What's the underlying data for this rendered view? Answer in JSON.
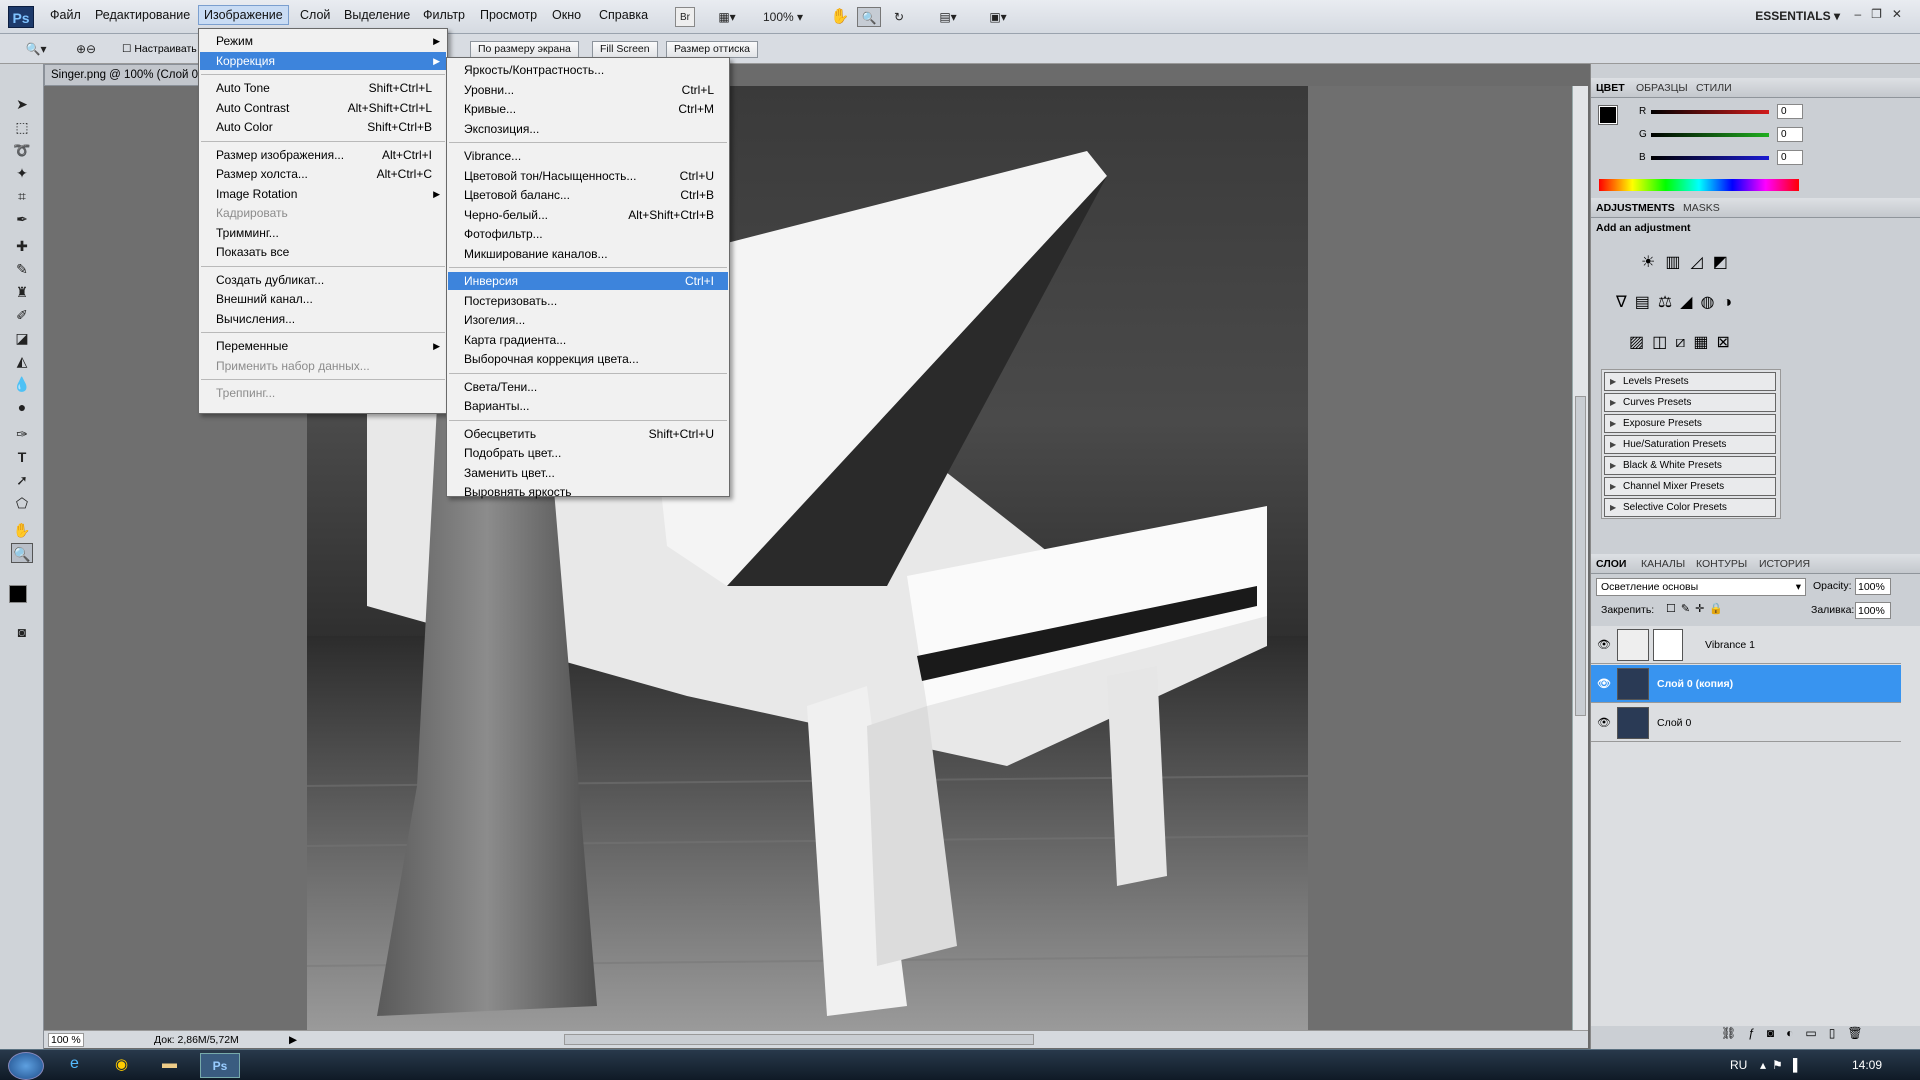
{
  "menubar": {
    "logo": "Ps",
    "items": [
      "Файл",
      "Редактирование",
      "Изображение",
      "Слой",
      "Выделение",
      "Фильтр",
      "Просмотр",
      "Окно",
      "Справка"
    ],
    "active_index": 2,
    "zoom": "100%",
    "workspace": "ESSENTIALS"
  },
  "options": {
    "resize_windows": "Настраивать",
    "buttons": [
      "По размеру экрана",
      "Fill Screen",
      "Размер оттиска"
    ]
  },
  "document": {
    "tab_title": "Singer.png @ 100% (Слой 0",
    "status_zoom": "100 %",
    "status_doc": "Док: 2,86M/5,72M"
  },
  "image_menu": {
    "items": [
      {
        "label": "Режим",
        "submenu": true
      },
      {
        "label": "Коррекция",
        "submenu": true,
        "highlight": true
      },
      {
        "label": "Auto Tone",
        "shortcut": "Shift+Ctrl+L"
      },
      {
        "label": "Auto Contrast",
        "shortcut": "Alt+Shift+Ctrl+L"
      },
      {
        "label": "Auto Color",
        "shortcut": "Shift+Ctrl+B"
      },
      {
        "label": "Размер изображения...",
        "shortcut": "Alt+Ctrl+I"
      },
      {
        "label": "Размер холста...",
        "shortcut": "Alt+Ctrl+C"
      },
      {
        "label": "Image Rotation",
        "submenu": true
      },
      {
        "label": "Кадрировать",
        "disabled": true
      },
      {
        "label": "Тримминг..."
      },
      {
        "label": "Показать все"
      },
      {
        "label": "Создать дубликат..."
      },
      {
        "label": "Внешний канал..."
      },
      {
        "label": "Вычисления..."
      },
      {
        "label": "Переменные",
        "submenu": true
      },
      {
        "label": "Применить набор данных...",
        "disabled": true
      },
      {
        "label": "Треппинг...",
        "disabled": true
      }
    ]
  },
  "correction_menu": {
    "items": [
      {
        "label": "Яркость/Контрастность..."
      },
      {
        "label": "Уровни...",
        "shortcut": "Ctrl+L"
      },
      {
        "label": "Кривые...",
        "shortcut": "Ctrl+M"
      },
      {
        "label": "Экспозиция..."
      },
      {
        "label": "Vibrance..."
      },
      {
        "label": "Цветовой тон/Насыщенность...",
        "shortcut": "Ctrl+U"
      },
      {
        "label": "Цветовой баланс...",
        "shortcut": "Ctrl+B"
      },
      {
        "label": "Черно-белый...",
        "shortcut": "Alt+Shift+Ctrl+B"
      },
      {
        "label": "Фотофильтр..."
      },
      {
        "label": "Микширование каналов..."
      },
      {
        "label": "Инверсия",
        "shortcut": "Ctrl+I",
        "highlight": true
      },
      {
        "label": "Постеризовать..."
      },
      {
        "label": "Изогелия..."
      },
      {
        "label": "Карта градиента..."
      },
      {
        "label": "Выборочная коррекция цвета..."
      },
      {
        "label": "Света/Тени..."
      },
      {
        "label": "Варианты..."
      },
      {
        "label": "Обесцветить",
        "shortcut": "Shift+Ctrl+U"
      },
      {
        "label": "Подобрать цвет..."
      },
      {
        "label": "Заменить цвет..."
      },
      {
        "label": "Выровнять яркость"
      }
    ]
  },
  "color_panel": {
    "tabs": [
      "ЦВЕТ",
      "ОБРАЗЦЫ",
      "СТИЛИ"
    ],
    "channels": [
      {
        "name": "R",
        "value": "0",
        "color": "#d21b1b"
      },
      {
        "name": "G",
        "value": "0",
        "color": "#1fae1f"
      },
      {
        "name": "B",
        "value": "0",
        "color": "#1b1bd2"
      }
    ]
  },
  "adjustments_panel": {
    "tabs": [
      "ADJUSTMENTS",
      "MASKS"
    ],
    "heading": "Add an adjustment",
    "presets": [
      "Levels Presets",
      "Curves Presets",
      "Exposure Presets",
      "Hue/Saturation Presets",
      "Black & White Presets",
      "Channel Mixer Presets",
      "Selective Color Presets"
    ]
  },
  "layers_panel": {
    "tabs": [
      "СЛОИ",
      "КАНАЛЫ",
      "КОНТУРЫ",
      "ИСТОРИЯ"
    ],
    "blend_mode": "Осветление основы",
    "opacity_label": "Opacity:",
    "opacity": "100%",
    "lock_label": "Закрепить:",
    "fill_label": "Заливка:",
    "fill": "100%",
    "layers": [
      {
        "name": "Vibrance 1",
        "selected": false
      },
      {
        "name": "Слой 0 (копия)",
        "selected": true
      },
      {
        "name": "Слой 0",
        "selected": false
      }
    ]
  },
  "taskbar": {
    "lang": "RU",
    "time": "14:09"
  },
  "colors": {
    "highlight": "#3d84dc",
    "layer_selected": "#3894f0"
  }
}
